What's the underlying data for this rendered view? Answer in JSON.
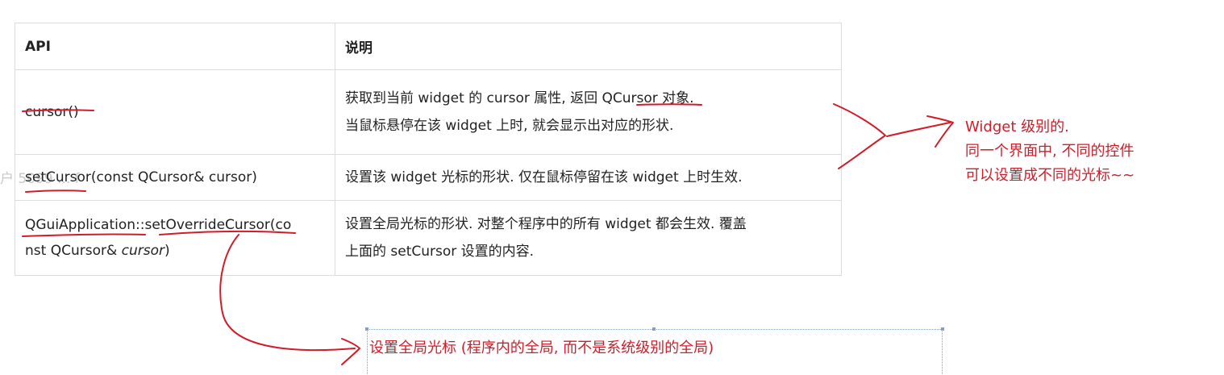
{
  "table": {
    "headers": {
      "api": "API",
      "desc": "说明"
    },
    "rows": [
      {
        "api": "cursor()",
        "desc_lines": [
          "获取到当前 widget 的 cursor 属性, 返回 QCursor 对象.",
          "当鼠标悬停在该 widget 上时, 就会显示出对应的形状."
        ]
      },
      {
        "api": "setCursor(const QCursor& cursor)",
        "desc_lines": [
          "设置该 widget 光标的形状. 仅在鼠标停留在该 widget 上时生效."
        ]
      },
      {
        "api_line1": "QGuiApplication::setOverrideCursor(co",
        "api_line2_prefix": "nst QCursor& ",
        "api_line2_italic": "cursor",
        "api_line2_suffix": ")",
        "desc_lines": [
          "设置全局光标的形状. 对整个程序中的所有 widget 都会生效. 覆盖",
          "上面的 setCursor 设置的内容."
        ]
      }
    ]
  },
  "annotations": {
    "right_note": [
      "Widget 级别的.",
      "同一个界面中, 不同的控件",
      "可以设置成不同的光标~~"
    ],
    "bottom_note": "设置全局光标 (程序内的全局, 而不是系统级别的全局)",
    "watermark": "户 5099 ... f"
  },
  "colors": {
    "ink": "#d01d2a",
    "border": "#dcdcdc",
    "text": "#222222"
  }
}
